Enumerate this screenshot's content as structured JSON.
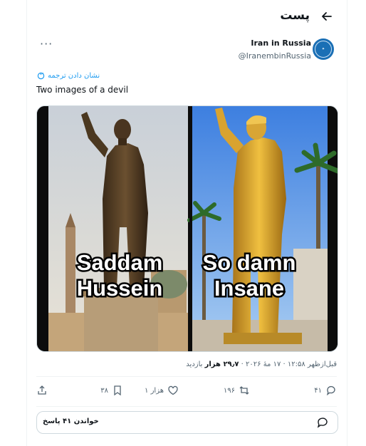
{
  "header": {
    "title": "پست"
  },
  "author": {
    "display_name": "Iran in Russia",
    "handle": "@IranembinRussia"
  },
  "translate_label": "نشان دادن ترجمه",
  "tweet_text": "Two images of a devil",
  "media": {
    "left_caption_line1": "Saddam",
    "left_caption_line2": "Hussein",
    "right_caption_line1": "So damn",
    "right_caption_line2": "Insane"
  },
  "meta": {
    "time_date": "قبل‌ازظهر ۱۲:۵۸ · ۱۷ مهٔ ۲۰۲۶ · ",
    "views_count": "۲۹٫۷ هزار",
    "views_label": " بازدید"
  },
  "actions": {
    "replies": "۴۱",
    "reposts": "۱۹۶",
    "likes": "۱ هزار",
    "bookmarks": "۳۸"
  },
  "read_replies_label": "خواندن ۴۱ پاسخ",
  "colors": {
    "accent": "#1d9bf0",
    "secondary_text": "#536471",
    "border": "#cfd9de"
  }
}
